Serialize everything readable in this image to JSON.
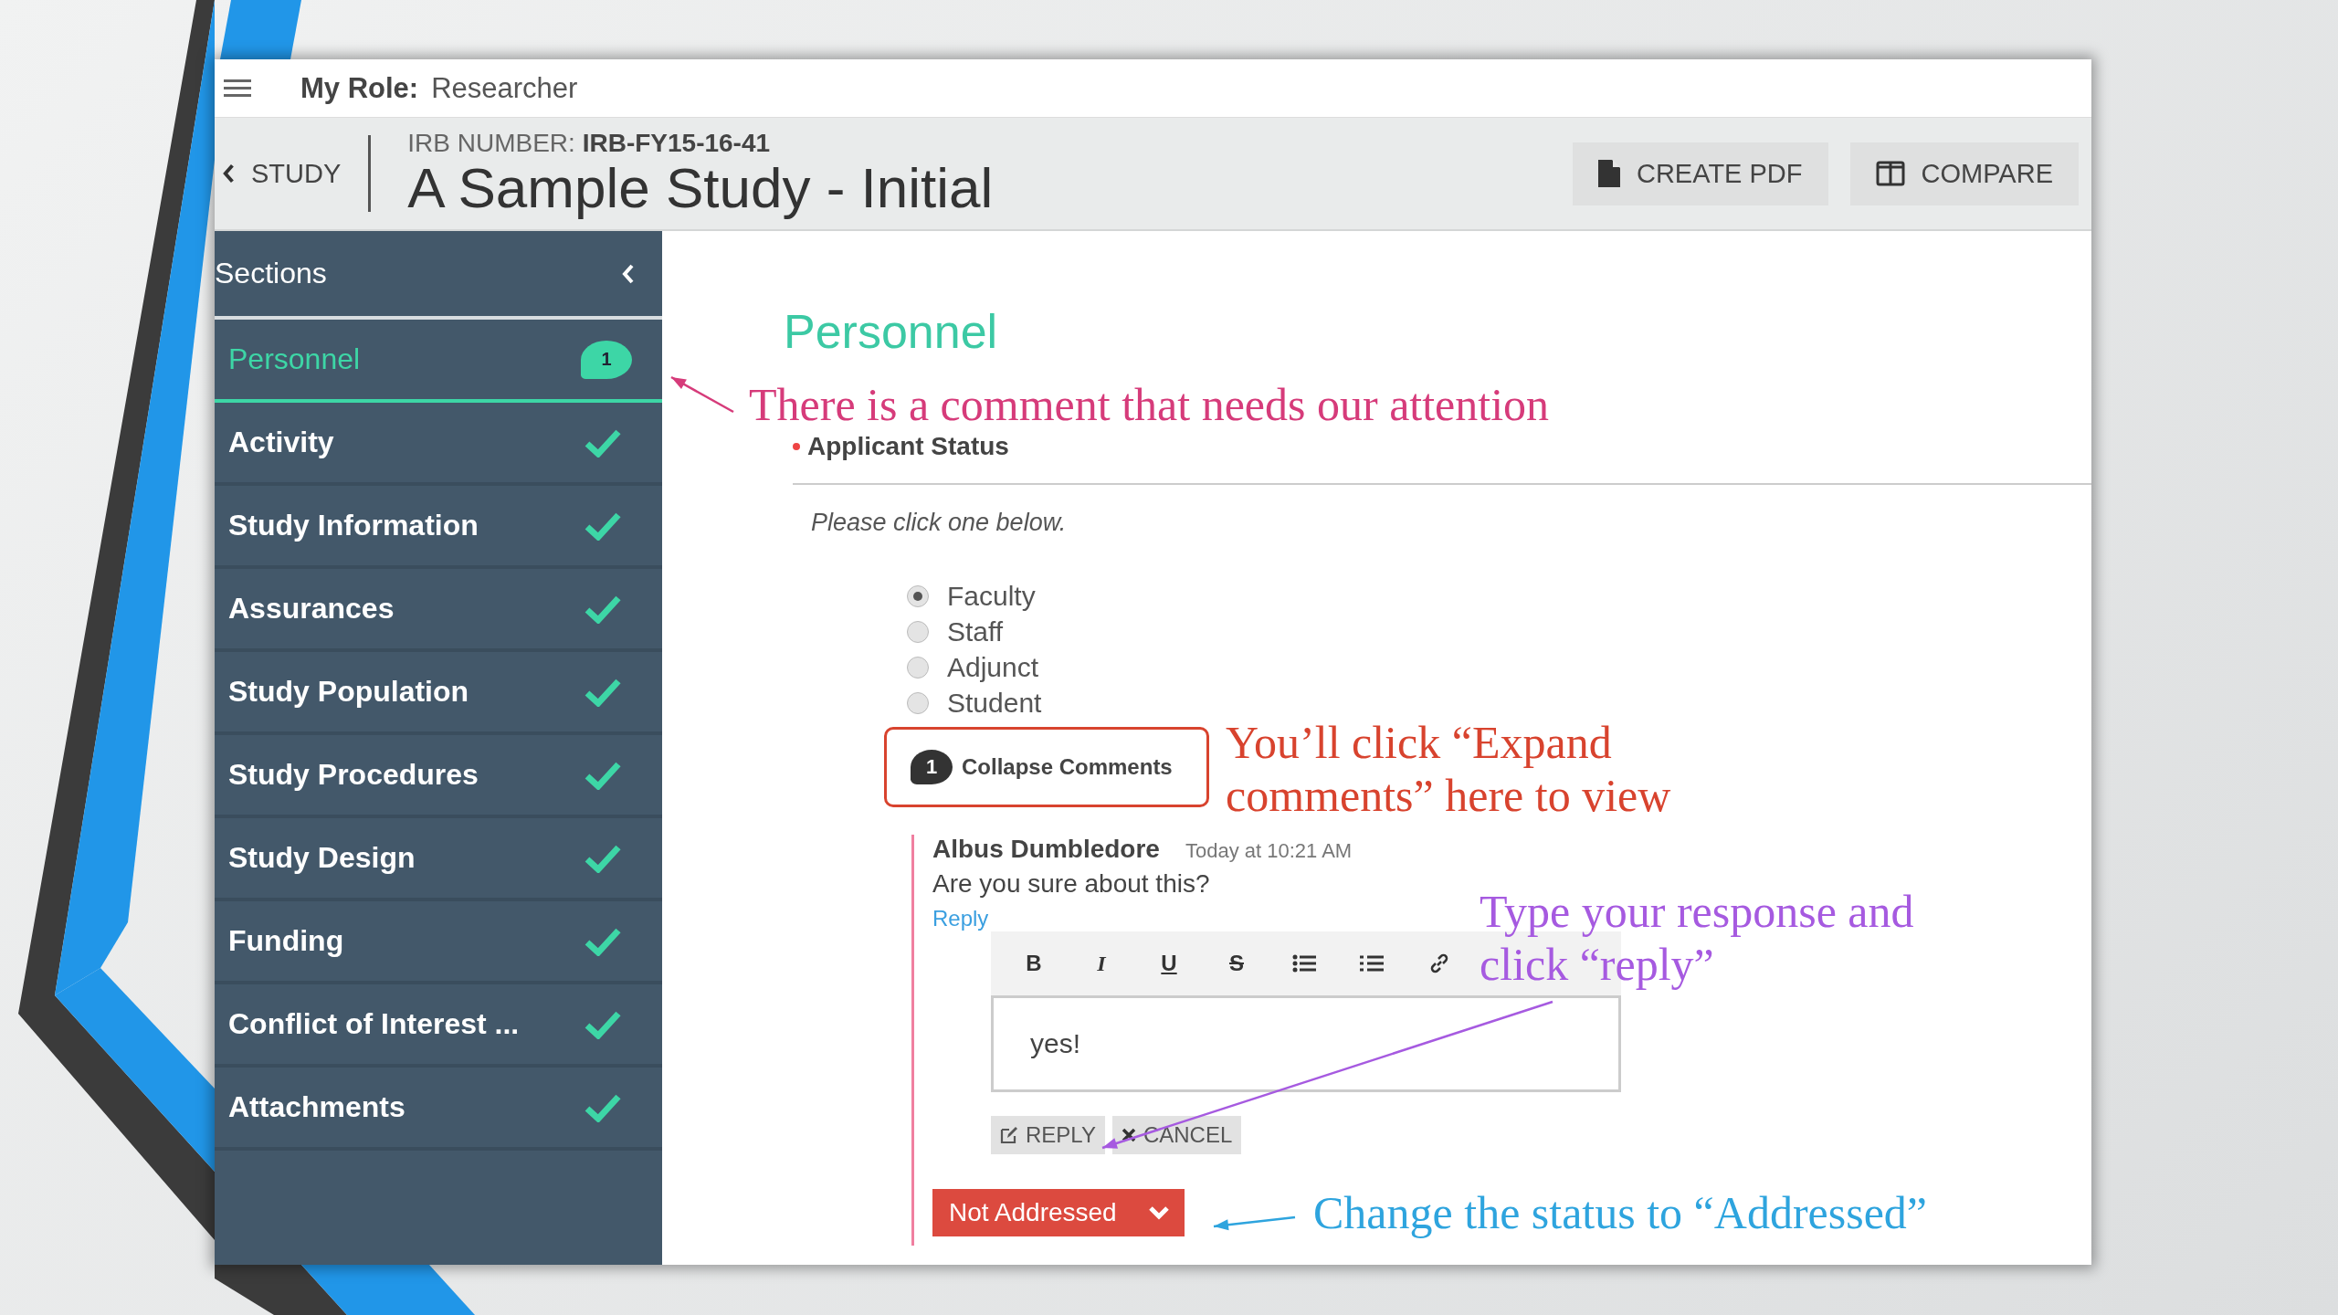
{
  "top_bar": {
    "role_label": "My Role:",
    "role": "Researcher"
  },
  "header": {
    "back": "STUDY",
    "irb_label": "IRB NUMBER:",
    "irb_number": "IRB-FY15-16-41",
    "title": "A Sample Study - Initial",
    "buttons": [
      {
        "kind": "pdf",
        "label": "CREATE PDF"
      },
      {
        "kind": "compare",
        "label": "COMPARE"
      }
    ]
  },
  "sidebar": {
    "title": "Sections",
    "items": [
      {
        "label": "Personnel",
        "selected": true,
        "kind": "comment",
        "badge": "1"
      },
      {
        "label": "Activity",
        "selected": false,
        "kind": "complete"
      },
      {
        "label": "Study Information",
        "selected": false,
        "kind": "complete"
      },
      {
        "label": "Assurances",
        "selected": false,
        "kind": "complete"
      },
      {
        "label": "Study Population",
        "selected": false,
        "kind": "complete"
      },
      {
        "label": "Study Procedures",
        "selected": false,
        "kind": "complete"
      },
      {
        "label": "Study Design",
        "selected": false,
        "kind": "complete"
      },
      {
        "label": "Funding",
        "selected": false,
        "kind": "complete"
      },
      {
        "label": "Conflict of Interest ...",
        "selected": false,
        "kind": "complete"
      },
      {
        "label": "Attachments",
        "selected": false,
        "kind": "complete"
      }
    ]
  },
  "content": {
    "heading": "Personnel",
    "field_label": "Applicant Status",
    "required": true,
    "instruction": "Please click one below.",
    "options": [
      {
        "label": "Faculty",
        "selected": true
      },
      {
        "label": "Staff",
        "selected": false
      },
      {
        "label": "Adjunct",
        "selected": false
      },
      {
        "label": "Student",
        "selected": false
      }
    ],
    "comments_toggle": {
      "badge": "1",
      "label": "Collapse Comments"
    },
    "comment": {
      "author": "Albus Dumbledore",
      "time": "Today at 10:21 AM",
      "text": "Are you sure about this?",
      "reply_link": "Reply"
    },
    "editor": {
      "tools": [
        {
          "kind": "bold",
          "label": "B"
        },
        {
          "kind": "italic",
          "label": "I"
        },
        {
          "kind": "underline",
          "label": "U"
        },
        {
          "kind": "strike",
          "label": "S"
        },
        {
          "kind": "bullets"
        },
        {
          "kind": "numbers"
        },
        {
          "kind": "link"
        }
      ],
      "value": "yes!"
    },
    "actions": [
      {
        "kind": "reply",
        "label": "REPLY"
      },
      {
        "kind": "cancel",
        "label": "CANCEL"
      }
    ],
    "status": "Not Addressed"
  },
  "annotations": [
    {
      "text": "There is a comment that needs our attention",
      "color": "#d63b7a"
    },
    {
      "text": "You’ll click “Expand comments” here to view",
      "color": "#d8432e"
    },
    {
      "text": "Type your response and click “reply”",
      "color": "#a65ae0"
    },
    {
      "text": "Change the status to “Addressed”",
      "color": "#2ea4de"
    }
  ]
}
